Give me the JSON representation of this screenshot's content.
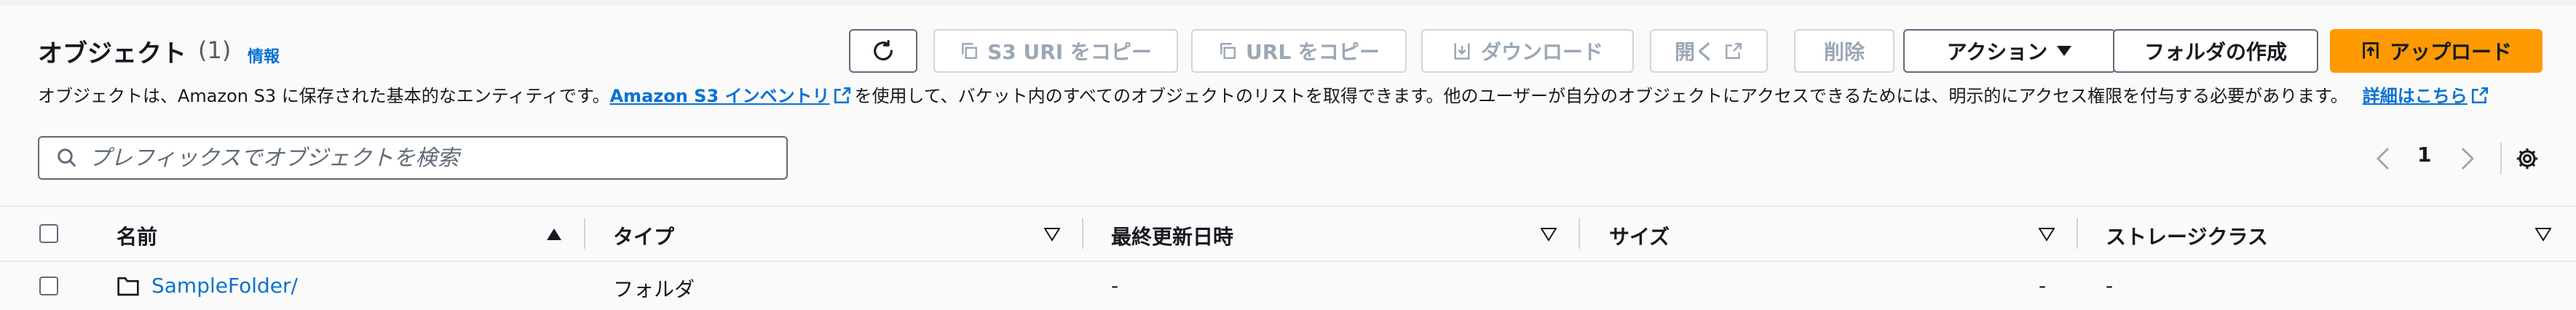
{
  "header": {
    "title": "オブジェクト",
    "count": "(1)",
    "info": "情報",
    "description_prefix": "オブジェクトは、Amazon S3 に保存された基本的なエンティティです。",
    "inventory_link": "Amazon S3 インベントリ",
    "description_middle": "を使用して、バケット内のすべてのオブジェクトのリストを取得できます。他のユーザーが自分のオブジェクトにアクセスできるためには、明示的にアクセス権限を付与する必要があります。",
    "details_link": "詳細はこちら"
  },
  "toolbar": {
    "copy_s3_uri": "S3 URI をコピー",
    "copy_url": "URL をコピー",
    "download": "ダウンロード",
    "open": "開く",
    "delete": "削除",
    "actions": "アクション",
    "create_folder": "フォルダの作成",
    "upload": "アップロード"
  },
  "search": {
    "placeholder": "プレフィックスでオブジェクトを検索"
  },
  "pagination": {
    "current_page": "1"
  },
  "table": {
    "columns": [
      "名前",
      "タイプ",
      "最終更新日時",
      "サイズ",
      "ストレージクラス"
    ],
    "rows": [
      {
        "name": "SampleFolder/",
        "type": "フォルダ",
        "last_modified": "-",
        "size": "-",
        "storage_class": "-"
      }
    ]
  },
  "colors": {
    "accent": "#ff9900",
    "link": "#0972d3",
    "border": "#5f6b7a",
    "disabled": "#9ba7b6"
  },
  "icons": [
    "refresh-icon",
    "copy-icon",
    "download-icon",
    "external-link-icon",
    "caret-down-icon",
    "upload-icon",
    "search-icon",
    "chevron-left-icon",
    "chevron-right-icon",
    "gear-icon",
    "sort-asc-icon",
    "sort-icon",
    "folder-icon"
  ]
}
